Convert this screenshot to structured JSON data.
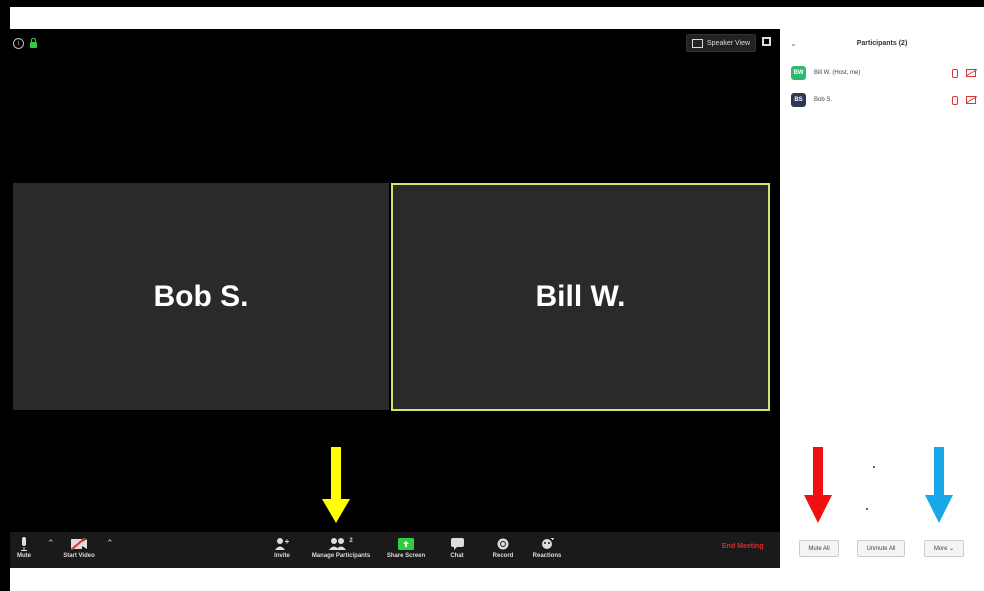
{
  "meeting": {
    "speaker_view_label": "Speaker View",
    "tiles": [
      {
        "name": "Bob S."
      },
      {
        "name": "Bill W."
      }
    ]
  },
  "toolbar": {
    "mute_label": "Mute",
    "start_video_label": "Start Video",
    "invite_label": "Invite",
    "manage_participants_label": "Manage Participants",
    "participant_count": "2",
    "share_screen_label": "Share Screen",
    "chat_label": "Chat",
    "record_label": "Record",
    "reactions_label": "Reactions",
    "end_meeting_label": "End Meeting"
  },
  "participants_panel": {
    "title": "Participants (2)",
    "participants": [
      {
        "initials": "BW",
        "name": "Bill W. (Host, me)",
        "color": "#2eb872"
      },
      {
        "initials": "BS",
        "name": "Bob S.",
        "color": "#2b3a55"
      }
    ],
    "mute_all_label": "Mute All",
    "unmute_all_label": "Unmute All",
    "more_label": "More ⌄"
  },
  "colors": {
    "active_speaker_border": "#d6e36a",
    "end_meeting": "#e02828",
    "arrow_yellow": "#ffff00",
    "arrow_red": "#ee1111",
    "arrow_blue": "#18a8e8",
    "share_screen_green": "#2ecc40"
  }
}
